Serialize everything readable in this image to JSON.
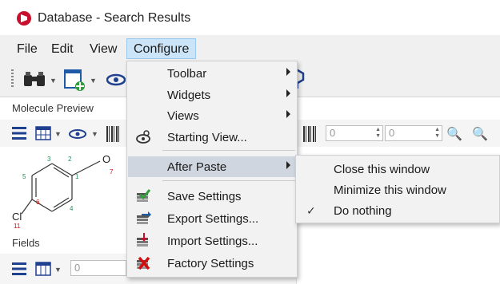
{
  "window": {
    "title": "Database - Search Results"
  },
  "menubar": {
    "items": [
      "File",
      "Edit",
      "View",
      "Configure"
    ],
    "active": "Configure"
  },
  "panels": {
    "preview_label": "Molecule Preview",
    "fields_label": "Fields",
    "spin_a": "0",
    "spin_b": "0",
    "spin_c": "0"
  },
  "molecule": {
    "atoms": {
      "o_label": "O",
      "o_num": "7",
      "cl_label": "Cl",
      "cl_num": "11",
      "n1": "1",
      "n2": "2",
      "n3": "3",
      "n4": "4",
      "n5": "5",
      "n6": "6"
    }
  },
  "configure_menu": {
    "items": [
      {
        "label": "Toolbar",
        "submenu": true
      },
      {
        "label": "Widgets",
        "submenu": true
      },
      {
        "label": "Views",
        "submenu": true
      },
      {
        "label": "Starting View...",
        "icon": "starting-view-icon"
      },
      {
        "label": "After Paste",
        "submenu": true,
        "highlighted": true
      },
      {
        "label": "Save Settings",
        "icon": "save-settings-icon"
      },
      {
        "label": "Export Settings...",
        "icon": "export-settings-icon"
      },
      {
        "label": "Import Settings...",
        "icon": "import-settings-icon"
      },
      {
        "label": "Factory Settings",
        "icon": "factory-settings-icon"
      }
    ]
  },
  "after_paste_submenu": {
    "items": [
      {
        "label": "Close this window",
        "checked": false
      },
      {
        "label": "Minimize this window",
        "checked": false
      },
      {
        "label": "Do nothing",
        "checked": true
      }
    ],
    "check_glyph": "✓"
  },
  "colors": {
    "accent": "#cce4f7",
    "menu_bg": "#f2f2f2",
    "highlight": "#cfd6e0",
    "brand": "#c8102e"
  }
}
